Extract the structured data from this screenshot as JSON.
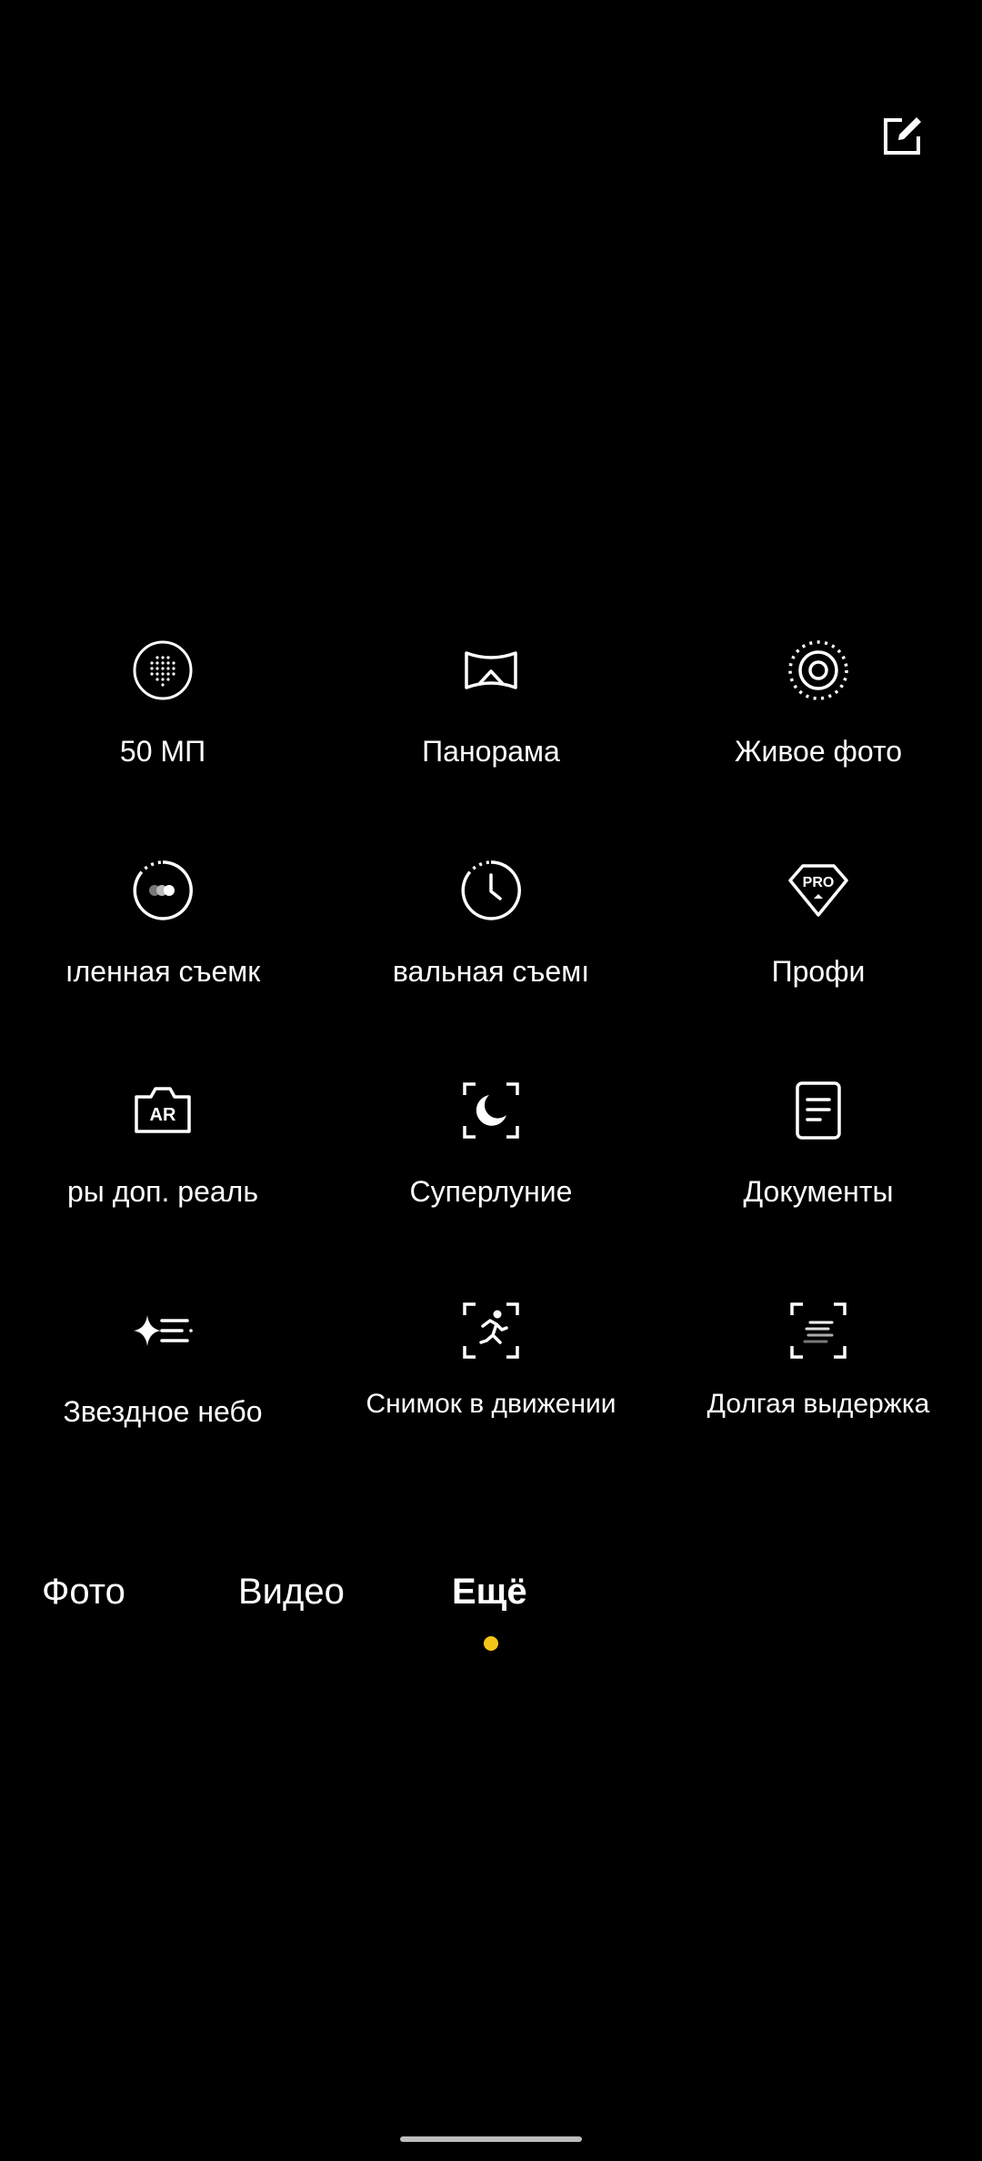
{
  "header": {
    "edit_icon": "edit-icon"
  },
  "modes": [
    {
      "label": "50 МП",
      "icon": "dotted-sphere-icon"
    },
    {
      "label": "Панорама",
      "icon": "panorama-icon"
    },
    {
      "label": "Живое фото",
      "icon": "live-photo-icon"
    },
    {
      "label": "ıленная съемк",
      "icon": "slow-motion-icon"
    },
    {
      "label": "вальная съемı",
      "icon": "time-lapse-icon"
    },
    {
      "label": "Профи",
      "icon": "pro-icon"
    },
    {
      "label": "ры доп. реаль",
      "icon": "ar-camera-icon"
    },
    {
      "label": "Суперлуние",
      "icon": "super-moon-icon"
    },
    {
      "label": "Документы",
      "icon": "document-icon"
    },
    {
      "label": "Звездное небо",
      "icon": "starry-sky-icon"
    },
    {
      "label": "Снимок в движении",
      "icon": "motion-shot-icon"
    },
    {
      "label": "Долгая выдержка",
      "icon": "long-exposure-icon"
    }
  ],
  "tabs": [
    {
      "label": "Фото"
    },
    {
      "label": "Видео"
    },
    {
      "label": "Ещё"
    }
  ],
  "active_tab": "Ещё",
  "colors": {
    "background": "#000000",
    "text": "#ffffff",
    "accent": "#f5c518"
  }
}
